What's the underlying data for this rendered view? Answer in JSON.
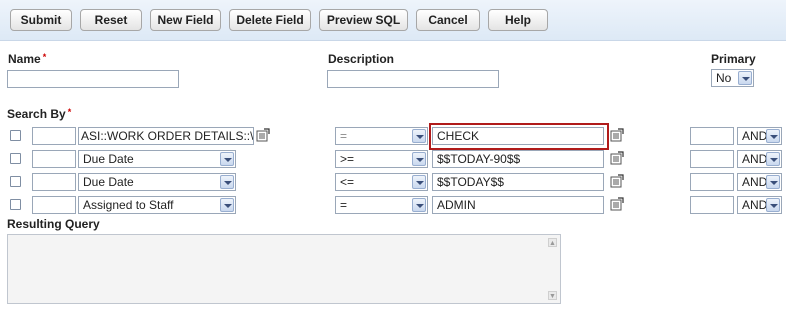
{
  "toolbar": {
    "submit": "Submit",
    "reset": "Reset",
    "new_field": "New Field",
    "delete_field": "Delete Field",
    "preview_sql": "Preview SQL",
    "cancel": "Cancel",
    "help": "Help"
  },
  "fields": {
    "name_label": "Name",
    "required_mark": "*",
    "name_value": "",
    "description_label": "Description",
    "description_value": "",
    "primary_label": "Primary",
    "primary_value": "No"
  },
  "search": {
    "label": "Search By",
    "required_mark": "*",
    "rows": [
      {
        "checked": false,
        "paren": "",
        "field": "ASI::WORK ORDER DETAILS::\\",
        "operator": "=",
        "value": "CHECK",
        "close": "",
        "conj": "AND"
      },
      {
        "checked": false,
        "paren": "",
        "field": "Due Date",
        "operator": ">=",
        "value": "$$TODAY-90$$",
        "close": "",
        "conj": "AND"
      },
      {
        "checked": false,
        "paren": "",
        "field": "Due Date",
        "operator": "<=",
        "value": "$$TODAY$$",
        "close": "",
        "conj": "AND"
      },
      {
        "checked": false,
        "paren": "",
        "field": "Assigned to Staff",
        "operator": "=",
        "value": "ADMIN",
        "close": "",
        "conj": "AND"
      }
    ]
  },
  "query": {
    "label": "Resulting Query",
    "value": ""
  },
  "icons": {
    "picker": "field-picker-icon",
    "scroll_up": "scroll-up-icon",
    "scroll_down": "scroll-down-icon"
  },
  "colors": {
    "toolbar_bg": "#e6eef8",
    "required": "#cc0000",
    "focus_border": "#b01b1b"
  }
}
